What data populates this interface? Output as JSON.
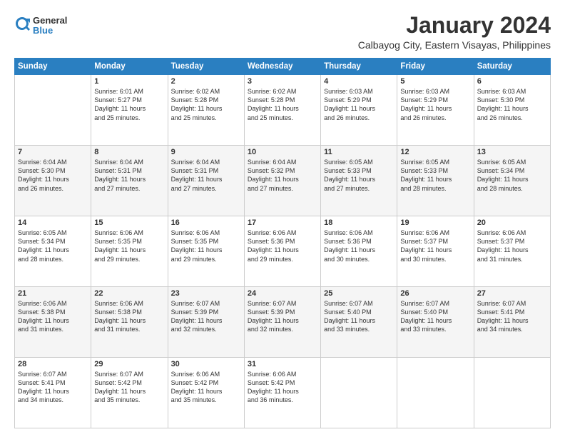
{
  "header": {
    "logo": {
      "general": "General",
      "blue": "Blue"
    },
    "title": "January 2024",
    "location": "Calbayog City, Eastern Visayas, Philippines"
  },
  "days_of_week": [
    "Sunday",
    "Monday",
    "Tuesday",
    "Wednesday",
    "Thursday",
    "Friday",
    "Saturday"
  ],
  "weeks": [
    [
      {
        "day": "",
        "info": ""
      },
      {
        "day": "1",
        "info": "Sunrise: 6:01 AM\nSunset: 5:27 PM\nDaylight: 11 hours\nand 25 minutes."
      },
      {
        "day": "2",
        "info": "Sunrise: 6:02 AM\nSunset: 5:28 PM\nDaylight: 11 hours\nand 25 minutes."
      },
      {
        "day": "3",
        "info": "Sunrise: 6:02 AM\nSunset: 5:28 PM\nDaylight: 11 hours\nand 25 minutes."
      },
      {
        "day": "4",
        "info": "Sunrise: 6:03 AM\nSunset: 5:29 PM\nDaylight: 11 hours\nand 26 minutes."
      },
      {
        "day": "5",
        "info": "Sunrise: 6:03 AM\nSunset: 5:29 PM\nDaylight: 11 hours\nand 26 minutes."
      },
      {
        "day": "6",
        "info": "Sunrise: 6:03 AM\nSunset: 5:30 PM\nDaylight: 11 hours\nand 26 minutes."
      }
    ],
    [
      {
        "day": "7",
        "info": "Sunrise: 6:04 AM\nSunset: 5:30 PM\nDaylight: 11 hours\nand 26 minutes."
      },
      {
        "day": "8",
        "info": "Sunrise: 6:04 AM\nSunset: 5:31 PM\nDaylight: 11 hours\nand 27 minutes."
      },
      {
        "day": "9",
        "info": "Sunrise: 6:04 AM\nSunset: 5:31 PM\nDaylight: 11 hours\nand 27 minutes."
      },
      {
        "day": "10",
        "info": "Sunrise: 6:04 AM\nSunset: 5:32 PM\nDaylight: 11 hours\nand 27 minutes."
      },
      {
        "day": "11",
        "info": "Sunrise: 6:05 AM\nSunset: 5:33 PM\nDaylight: 11 hours\nand 27 minutes."
      },
      {
        "day": "12",
        "info": "Sunrise: 6:05 AM\nSunset: 5:33 PM\nDaylight: 11 hours\nand 28 minutes."
      },
      {
        "day": "13",
        "info": "Sunrise: 6:05 AM\nSunset: 5:34 PM\nDaylight: 11 hours\nand 28 minutes."
      }
    ],
    [
      {
        "day": "14",
        "info": "Sunrise: 6:05 AM\nSunset: 5:34 PM\nDaylight: 11 hours\nand 28 minutes."
      },
      {
        "day": "15",
        "info": "Sunrise: 6:06 AM\nSunset: 5:35 PM\nDaylight: 11 hours\nand 29 minutes."
      },
      {
        "day": "16",
        "info": "Sunrise: 6:06 AM\nSunset: 5:35 PM\nDaylight: 11 hours\nand 29 minutes."
      },
      {
        "day": "17",
        "info": "Sunrise: 6:06 AM\nSunset: 5:36 PM\nDaylight: 11 hours\nand 29 minutes."
      },
      {
        "day": "18",
        "info": "Sunrise: 6:06 AM\nSunset: 5:36 PM\nDaylight: 11 hours\nand 30 minutes."
      },
      {
        "day": "19",
        "info": "Sunrise: 6:06 AM\nSunset: 5:37 PM\nDaylight: 11 hours\nand 30 minutes."
      },
      {
        "day": "20",
        "info": "Sunrise: 6:06 AM\nSunset: 5:37 PM\nDaylight: 11 hours\nand 31 minutes."
      }
    ],
    [
      {
        "day": "21",
        "info": "Sunrise: 6:06 AM\nSunset: 5:38 PM\nDaylight: 11 hours\nand 31 minutes."
      },
      {
        "day": "22",
        "info": "Sunrise: 6:06 AM\nSunset: 5:38 PM\nDaylight: 11 hours\nand 31 minutes."
      },
      {
        "day": "23",
        "info": "Sunrise: 6:07 AM\nSunset: 5:39 PM\nDaylight: 11 hours\nand 32 minutes."
      },
      {
        "day": "24",
        "info": "Sunrise: 6:07 AM\nSunset: 5:39 PM\nDaylight: 11 hours\nand 32 minutes."
      },
      {
        "day": "25",
        "info": "Sunrise: 6:07 AM\nSunset: 5:40 PM\nDaylight: 11 hours\nand 33 minutes."
      },
      {
        "day": "26",
        "info": "Sunrise: 6:07 AM\nSunset: 5:40 PM\nDaylight: 11 hours\nand 33 minutes."
      },
      {
        "day": "27",
        "info": "Sunrise: 6:07 AM\nSunset: 5:41 PM\nDaylight: 11 hours\nand 34 minutes."
      }
    ],
    [
      {
        "day": "28",
        "info": "Sunrise: 6:07 AM\nSunset: 5:41 PM\nDaylight: 11 hours\nand 34 minutes."
      },
      {
        "day": "29",
        "info": "Sunrise: 6:07 AM\nSunset: 5:42 PM\nDaylight: 11 hours\nand 35 minutes."
      },
      {
        "day": "30",
        "info": "Sunrise: 6:06 AM\nSunset: 5:42 PM\nDaylight: 11 hours\nand 35 minutes."
      },
      {
        "day": "31",
        "info": "Sunrise: 6:06 AM\nSunset: 5:42 PM\nDaylight: 11 hours\nand 36 minutes."
      },
      {
        "day": "",
        "info": ""
      },
      {
        "day": "",
        "info": ""
      },
      {
        "day": "",
        "info": ""
      }
    ]
  ]
}
